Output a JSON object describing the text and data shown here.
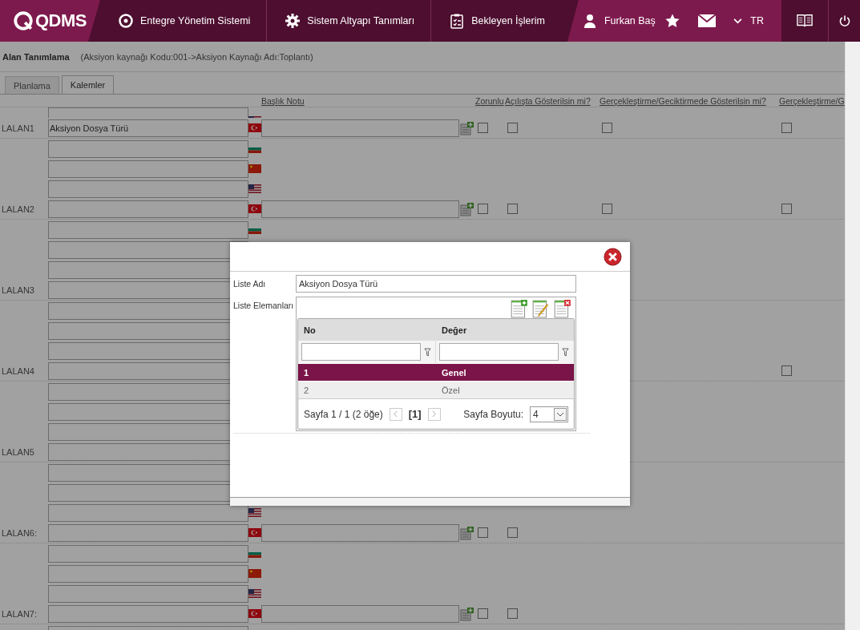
{
  "nav": {
    "logo": "QDMS",
    "menu": [
      {
        "label": "Entegre Yönetim Sistemi",
        "kind": "app"
      },
      {
        "label": "Sistem Altyapı Tanımları",
        "kind": "settings"
      },
      {
        "label": "Bekleyen İşlerim",
        "kind": "tasks"
      }
    ],
    "user": "Furkan Baş",
    "language": "TR"
  },
  "page": {
    "title": "Alan Tanımlama",
    "subtitle": "(Aksiyon kaynağı Kodu:001->Aksiyon Kaynağı Adı:Toplantı)"
  },
  "tabs": [
    {
      "label": "Planlama",
      "selected": false
    },
    {
      "label": "Kalemler",
      "selected": true
    }
  ],
  "columns": [
    "Başlık Notu",
    "Zorunlu",
    "Açılışta Gösterilsin mi?",
    "Gerçekleştirme/Geciktirmede Gösterilsin mi?",
    "Gerçekleştirme/G"
  ],
  "fields": [
    {
      "label": "LALAN1",
      "kind": "full",
      "name": "Aksiyon Dosya Türü",
      "checks": [
        false,
        false,
        false,
        false
      ]
    },
    {
      "label": "LALAN2",
      "kind": "full",
      "checks": [
        false,
        false,
        false,
        false
      ]
    },
    {
      "label": "LALAN3",
      "kind": "partial"
    },
    {
      "label": "LALAN4",
      "kind": "partial",
      "end_check": false
    },
    {
      "label": "LALAN5",
      "kind": "partial",
      "end_flag": true
    },
    {
      "label": "LALAN6:",
      "kind": "full",
      "checks": [
        false,
        false
      ]
    },
    {
      "label": "LALAN7:",
      "kind": "cut",
      "checks": [
        false,
        false
      ]
    }
  ],
  "dialog": {
    "list_name_label": "Liste Adı",
    "list_name": "Aksiyon Dosya Türü",
    "items_label": "Liste Elemanları",
    "grid": {
      "columns": [
        "No",
        "Değer"
      ],
      "rows": [
        {
          "no": "1",
          "value": "Genel",
          "selected": true
        },
        {
          "no": "2",
          "value": "Özel",
          "selected": false
        }
      ],
      "pager": {
        "summary": "Sayfa 1 / 1 (2 öğe)",
        "current": "[1]",
        "size_label": "Sayfa Boyutu:",
        "size": "4"
      }
    }
  }
}
